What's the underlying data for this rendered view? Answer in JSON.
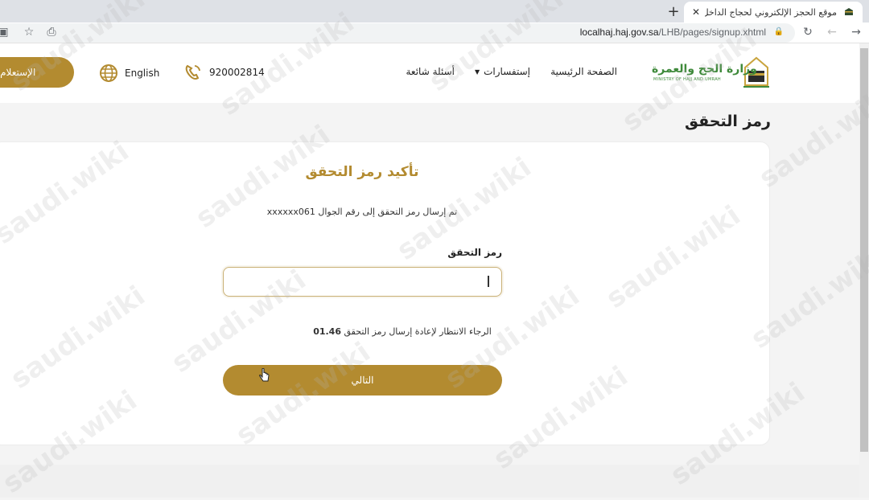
{
  "browser": {
    "tab_title": "موقع الحجز الإلكتروني لحجاج الداخل",
    "url_host": "localhaj.haj.gov.sa",
    "url_path": "/LHB/pages/signup.xhtml"
  },
  "header": {
    "logo_ar": "وزارة الحج والعمرة",
    "logo_en": "MINISTRY OF HAJJ AND UMRAH",
    "nav": {
      "home": "الصفحة الرئيسية",
      "inquiries": "إستفسارات",
      "faq": "أسئلة شائعة"
    },
    "phone": "920002814",
    "language": "English",
    "inquiry_button": "الإستعلام عن"
  },
  "page": {
    "title": "رمز التحقق",
    "card_title": "تأكيد رمز التحقق",
    "sent_message": "تم إرسال رمز التحقق إلى رقم الجوال xxxxxx061",
    "code_label": "رمز التحقق",
    "code_value": "",
    "wait_message": "الرجاء الانتظار لإعادة إرسال رمز التحقق",
    "timer": "01.46",
    "next_button": "التالي"
  },
  "watermark": "saudi.wiki",
  "colors": {
    "accent": "#b38b30",
    "logo_green": "#3f8a3b"
  }
}
